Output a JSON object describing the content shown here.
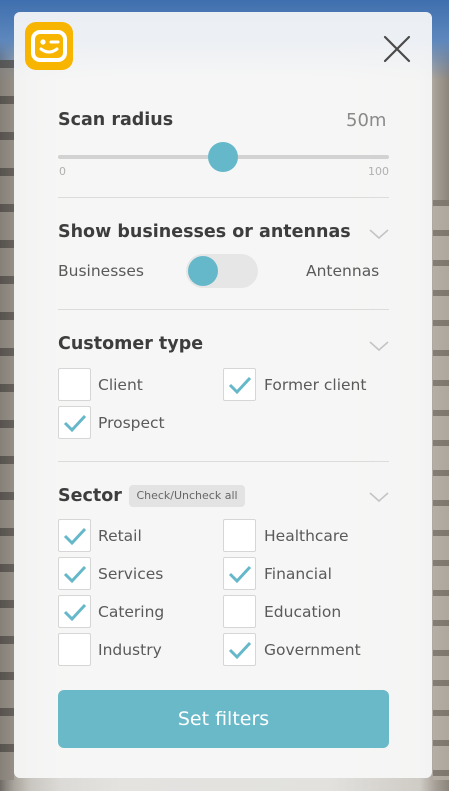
{
  "scan_radius": {
    "title": "Scan radius",
    "value": "50m",
    "min_label": "0",
    "max_label": "100",
    "level": 0.5
  },
  "mode": {
    "title": "Show businesses or antennas",
    "left_label": "Businesses",
    "right_label": "Antennas",
    "selected": "Businesses"
  },
  "customer_type": {
    "title": "Customer type",
    "options": [
      {
        "label": "Client",
        "checked": false
      },
      {
        "label": "Former client",
        "checked": true
      },
      {
        "label": "Prospect",
        "checked": true
      }
    ]
  },
  "sector": {
    "title": "Sector",
    "toggle_all_label": "Check/Uncheck all",
    "options": [
      {
        "label": "Retail",
        "checked": true
      },
      {
        "label": "Healthcare",
        "checked": false
      },
      {
        "label": "Services",
        "checked": true
      },
      {
        "label": "Financial",
        "checked": true
      },
      {
        "label": "Catering",
        "checked": true
      },
      {
        "label": "Education",
        "checked": false
      },
      {
        "label": "Industry",
        "checked": false
      },
      {
        "label": "Government",
        "checked": true
      }
    ]
  },
  "submit_label": "Set filters",
  "colors": {
    "accent": "#65b8c9",
    "brand": "#f7b500"
  },
  "icons": {
    "logo": "smiley-logo-icon",
    "close": "close-icon",
    "chevron": "chevron-down-icon",
    "check": "checkmark-icon"
  }
}
